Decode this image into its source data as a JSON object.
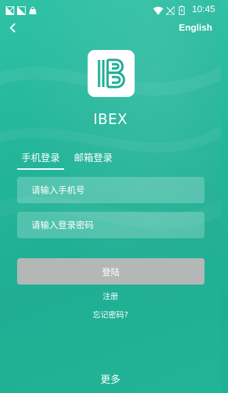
{
  "status_bar": {
    "time": "10:45",
    "left_icons": [
      "no-sim-icon",
      "no-sim-icon",
      "shopping-bag-icon"
    ],
    "right_icons": [
      "wifi-icon",
      "no-signal-icon",
      "battery-charging-icon"
    ]
  },
  "header": {
    "back_icon": "chevron-left-icon",
    "language_link": "English"
  },
  "app": {
    "name": "IBEX",
    "logo_letter": "B"
  },
  "tabs": [
    {
      "label": "手机登录",
      "active": true
    },
    {
      "label": "邮箱登录",
      "active": false
    }
  ],
  "form": {
    "phone_placeholder": "请输入手机号",
    "password_placeholder": "请输入登录密码",
    "login_label": "登陆",
    "register_label": "注册",
    "forgot_label": "忘记密码?"
  },
  "footer": {
    "more_label": "更多"
  },
  "colors": {
    "background": "#23b59a",
    "button_disabled": "#b3b8b6",
    "logo_accent": "#1fae93"
  }
}
